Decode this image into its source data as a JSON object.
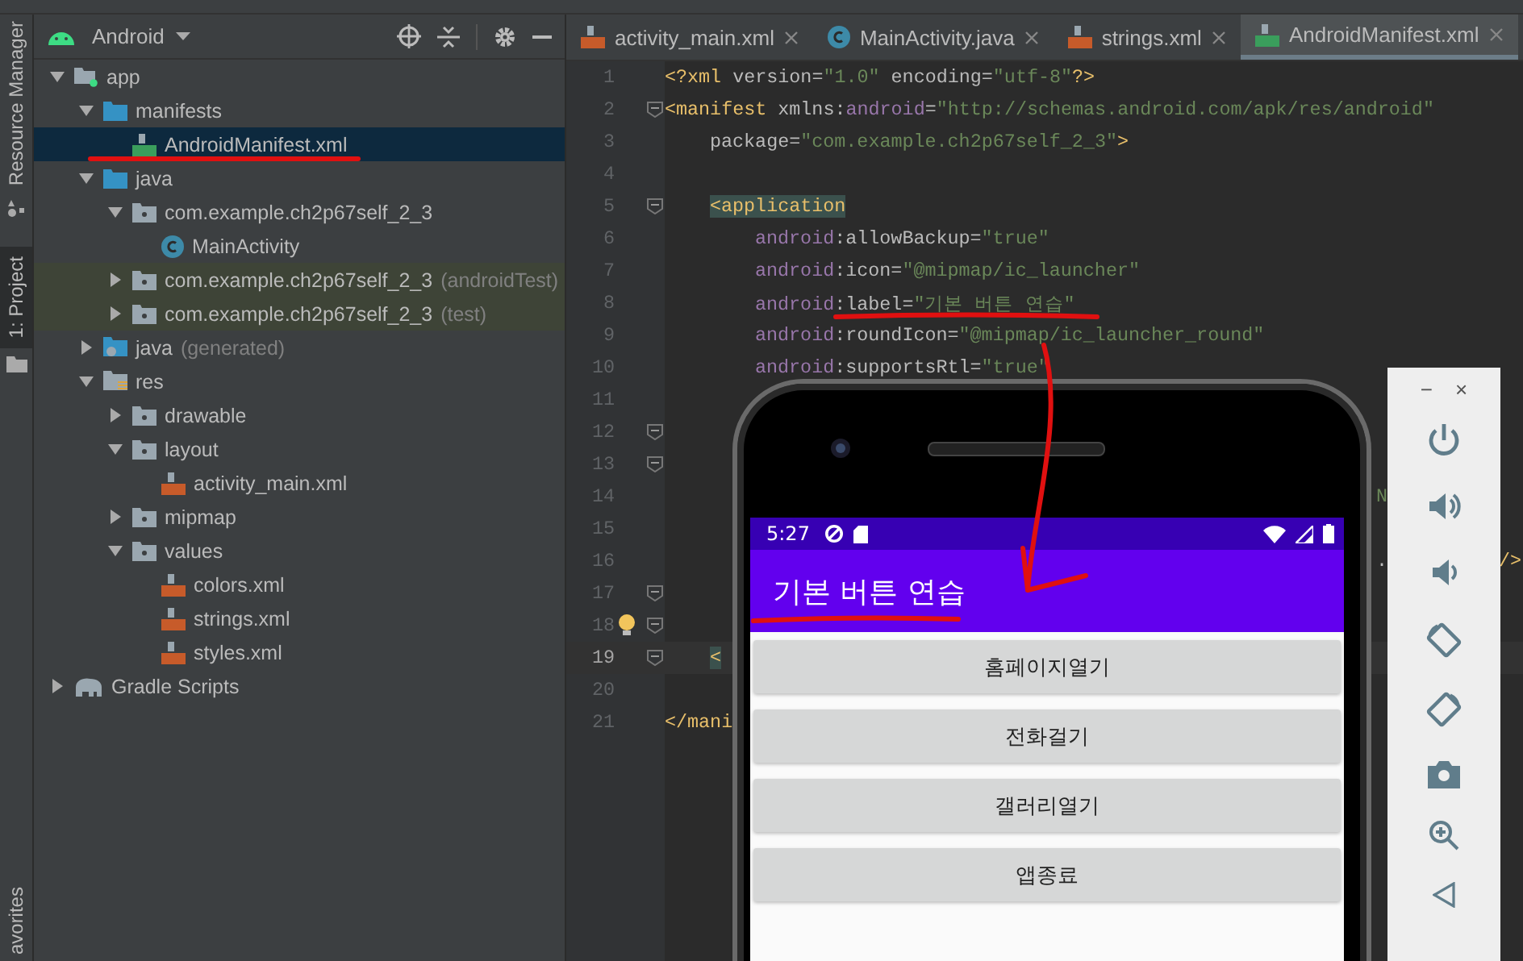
{
  "tool_strip": [
    {
      "label": "Resource Manager",
      "selected": false
    },
    {
      "label": "1: Project",
      "selected": true
    },
    {
      "label": "avorites",
      "selected": false
    }
  ],
  "project_panel": {
    "view": "Android"
  },
  "tree": [
    {
      "label": "app",
      "kind": "module",
      "expanded": true,
      "selected": false,
      "children": [
        {
          "label": "manifests",
          "kind": "folder",
          "expanded": true,
          "selected": false,
          "children": [
            {
              "label": "AndroidManifest.xml",
              "kind": "manifest",
              "selected": true
            }
          ]
        },
        {
          "label": "java",
          "kind": "folder",
          "expanded": true,
          "selected": false,
          "children": [
            {
              "label": "com.example.ch2p67self_2_3",
              "kind": "package",
              "expanded": true,
              "selected": false,
              "children": [
                {
                  "label": "MainActivity",
                  "kind": "class",
                  "selected": false
                }
              ]
            },
            {
              "label": "com.example.ch2p67self_2_3",
              "note": "(androidTest)",
              "kind": "test-package",
              "expanded": false,
              "selected": false
            },
            {
              "label": "com.example.ch2p67self_2_3",
              "note": "(test)",
              "kind": "test-package",
              "expanded": false,
              "selected": false
            }
          ]
        },
        {
          "label": "java",
          "note": "(generated)",
          "kind": "gen-folder",
          "expanded": false,
          "selected": false
        },
        {
          "label": "res",
          "kind": "res-folder",
          "expanded": true,
          "selected": false,
          "children": [
            {
              "label": "drawable",
              "kind": "package",
              "expanded": false,
              "selected": false
            },
            {
              "label": "layout",
              "kind": "package",
              "expanded": true,
              "selected": false,
              "children": [
                {
                  "label": "activity_main.xml",
                  "kind": "xml",
                  "selected": false
                }
              ]
            },
            {
              "label": "mipmap",
              "kind": "package",
              "expanded": false,
              "selected": false
            },
            {
              "label": "values",
              "kind": "package",
              "expanded": true,
              "selected": false,
              "children": [
                {
                  "label": "colors.xml",
                  "kind": "xml",
                  "selected": false
                },
                {
                  "label": "strings.xml",
                  "kind": "xml",
                  "selected": false
                },
                {
                  "label": "styles.xml",
                  "kind": "xml",
                  "selected": false
                }
              ]
            }
          ]
        }
      ]
    },
    {
      "label": "Gradle Scripts",
      "kind": "gradle",
      "expanded": false,
      "selected": false
    }
  ],
  "tabs": [
    {
      "label": "activity_main.xml",
      "kind": "xml",
      "selected": false
    },
    {
      "label": "MainActivity.java",
      "kind": "class",
      "selected": false
    },
    {
      "label": "strings.xml",
      "kind": "xml",
      "selected": false
    },
    {
      "label": "AndroidManifest.xml",
      "kind": "manifest",
      "selected": true
    }
  ],
  "code_lines": [
    {
      "number": "1",
      "kind": "top",
      "tokens": [
        {
          "kind": "tag",
          "text": "<?xml "
        },
        {
          "kind": "plain",
          "text": "version="
        },
        {
          "kind": "value",
          "text": "\"1.0\""
        },
        {
          "kind": "plain",
          "text": " encoding="
        },
        {
          "kind": "value",
          "text": "\"utf-8\""
        },
        {
          "kind": "tag",
          "text": "?>"
        }
      ]
    },
    {
      "number": "2",
      "kind": "top",
      "fold": true,
      "tokens": [
        {
          "kind": "tag",
          "text": "<manifest "
        },
        {
          "kind": "plain",
          "text": "xmlns:"
        },
        {
          "kind": "ns",
          "text": "android"
        },
        {
          "kind": "plain",
          "text": "="
        },
        {
          "kind": "value",
          "text": "\"http://schemas.android.com/apk/res/android\""
        }
      ]
    },
    {
      "number": "3",
      "kind": "inner",
      "tokens": [
        {
          "kind": "plain",
          "text": "package="
        },
        {
          "kind": "value",
          "text": "\"com.example.ch2p67self_2_3\""
        },
        {
          "kind": "tag",
          "text": ">"
        }
      ]
    },
    {
      "number": "4"
    },
    {
      "number": "5",
      "kind": "inner",
      "fold": true,
      "tokens": [
        {
          "kind": "tag-match",
          "text": "<application"
        }
      ]
    },
    {
      "number": "6",
      "kind": "attr",
      "tokens": [
        {
          "kind": "ns",
          "text": "android"
        },
        {
          "kind": "plain",
          "text": ":allowBackup="
        },
        {
          "kind": "value",
          "text": "\"true\""
        }
      ]
    },
    {
      "number": "7",
      "kind": "attr",
      "tokens": [
        {
          "kind": "ns",
          "text": "android"
        },
        {
          "kind": "plain",
          "text": ":icon="
        },
        {
          "kind": "value",
          "text": "\"@mipmap/ic_launcher\""
        }
      ]
    },
    {
      "number": "8",
      "kind": "attr",
      "tokens": [
        {
          "kind": "ns",
          "text": "android"
        },
        {
          "kind": "plain",
          "text": ":label="
        },
        {
          "kind": "value",
          "text": "\"기본 버튼 연습\""
        }
      ]
    },
    {
      "number": "9",
      "kind": "attr",
      "tokens": [
        {
          "kind": "ns",
          "text": "android"
        },
        {
          "kind": "plain",
          "text": ":roundIcon="
        },
        {
          "kind": "value",
          "text": "\"@mipmap/ic_launcher_round\""
        }
      ]
    },
    {
      "number": "10",
      "kind": "attr",
      "tokens": [
        {
          "kind": "ns",
          "text": "android"
        },
        {
          "kind": "plain",
          "text": ":supportsRtl="
        },
        {
          "kind": "value",
          "text": "\"true\""
        }
      ]
    },
    {
      "number": "11"
    },
    {
      "number": "12",
      "fold": true
    },
    {
      "number": "13",
      "fold": true
    },
    {
      "number": "14",
      "right": [
        {
          "kind": "value",
          "text": "N"
        }
      ]
    },
    {
      "number": "15"
    },
    {
      "number": "16",
      "right": [
        {
          "kind": "plain",
          "text": "."
        },
        {
          "kind": "tag",
          "text": "/>"
        }
      ]
    },
    {
      "number": "17",
      "fold": true
    },
    {
      "number": "18",
      "fold": true,
      "bulb": true
    },
    {
      "number": "19",
      "kind": "inner",
      "fold": true,
      "current": true,
      "tokens": [
        {
          "kind": "tag-match",
          "text": "<"
        }
      ]
    },
    {
      "number": "20"
    },
    {
      "number": "21",
      "kind": "top",
      "tokens": [
        {
          "kind": "tag",
          "text": "</mani"
        }
      ]
    }
  ],
  "phone": {
    "time": "5:27",
    "app_title": "기본 버튼 연습",
    "buttons": [
      "홈페이지열기",
      "전화걸기",
      "갤러리열기",
      "앱종료"
    ]
  },
  "emulator_panel": {
    "window_controls": [
      "−",
      "×"
    ]
  }
}
